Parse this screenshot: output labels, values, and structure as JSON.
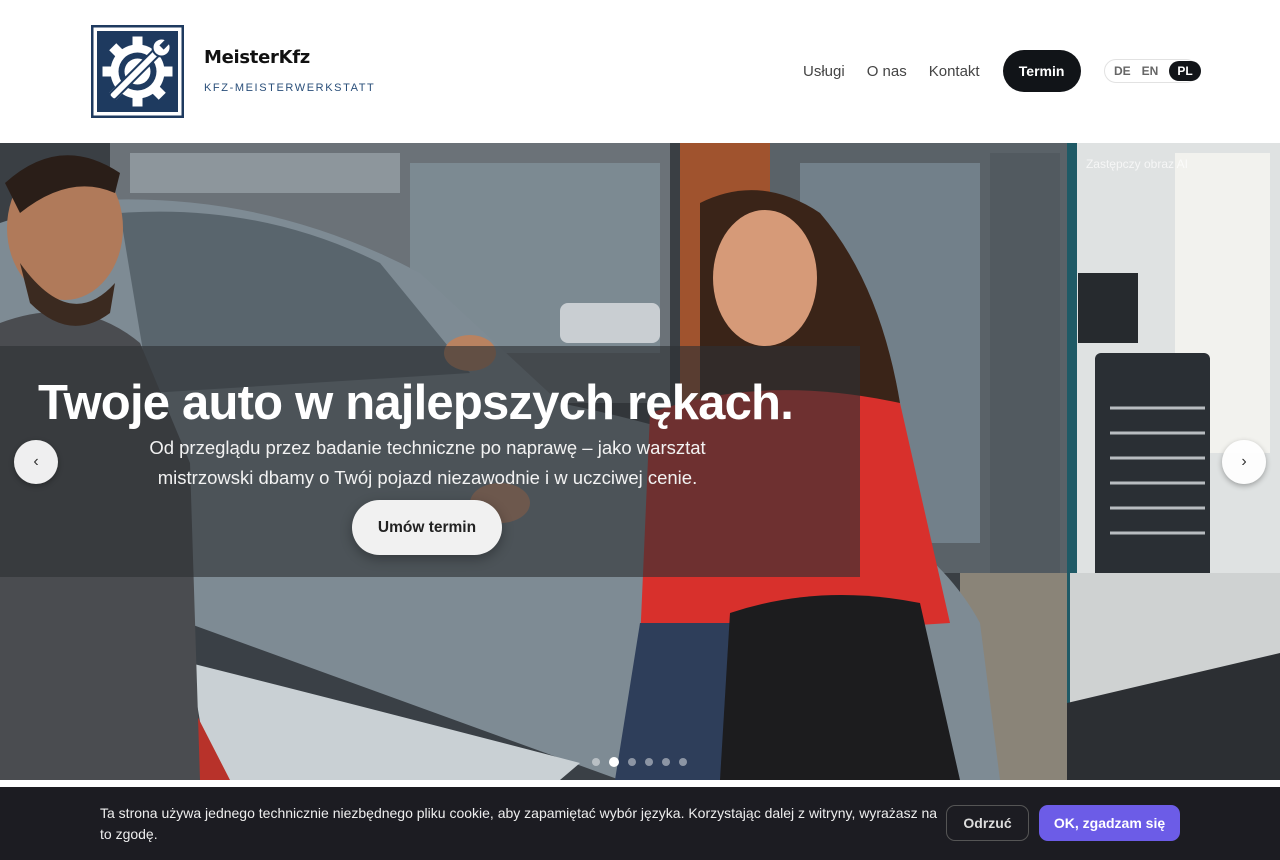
{
  "brand": {
    "name": "MeisterKfz",
    "tagline": "KFZ-MEISTERWERKSTATT",
    "logo_icon": "gear-wrench-icon"
  },
  "nav": {
    "items": [
      "Usługi",
      "O nas",
      "Kontakt"
    ],
    "cta_label": "Termin"
  },
  "languages": {
    "options": [
      "DE",
      "EN",
      "PL"
    ],
    "active": "PL"
  },
  "hero": {
    "image_note": "Zastępczy obraz AI",
    "title": "Twoje auto w najlepszych rękach.",
    "subtitle": "Od przeglądu przez badanie techniczne po naprawę – jako warsztat mistrzowski dbamy o Twój pojazd niezawodnie i w uczciwej cenie.",
    "cta_label": "Umów termin",
    "prev_icon": "‹",
    "next_icon": "›",
    "slide_count": 6,
    "active_slide": 2
  },
  "cookie": {
    "text": "Ta strona używa jednego technicznie niezbędnego pliku cookie, aby zapamiętać wybór języka. Korzystając dalej z witryny, wyrażasz na to zgodę.",
    "decline_label": "Odrzuć",
    "accept_label": "OK, zgadzam się",
    "accept_color": "#6c5ce7"
  }
}
